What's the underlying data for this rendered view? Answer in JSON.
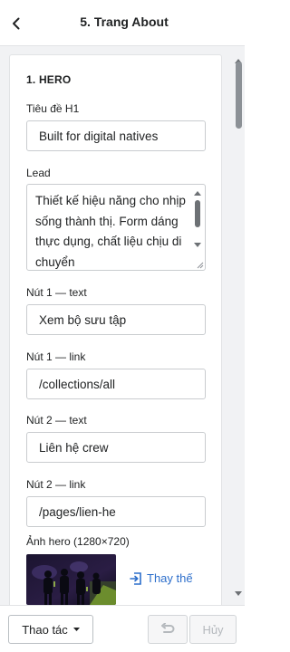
{
  "header": {
    "title": "5. Trang About",
    "back_icon": "chevron-left-icon"
  },
  "section": {
    "title": "1. HERO"
  },
  "fields": {
    "h1_label": "Tiêu đề H1",
    "h1_value": "Built for digital natives",
    "lead_label": "Lead",
    "lead_value": "Thiết kế hiệu năng cho nhịp sống thành thị. Form dáng thực dụng, chất liệu chịu di chuyển",
    "btn1_text_label": "Nút 1 — text",
    "btn1_text_value": "Xem bộ sưu tập",
    "btn1_link_label": "Nút 1 — link",
    "btn1_link_value": "/collections/all",
    "btn2_text_label": "Nút 2 — text",
    "btn2_text_value": "Liên hệ crew",
    "btn2_link_label": "Nút 2 — link",
    "btn2_link_value": "/pages/lien-he",
    "hero_image_label": "Ảnh hero (1280×720)",
    "replace_label": "Thay thế"
  },
  "footer": {
    "actions_label": "Thao tác",
    "cancel_label": "Hủy",
    "undo_icon": "undo-icon"
  },
  "colors": {
    "link": "#2c6ecb",
    "text": "#202223",
    "border": "#c9cccf",
    "panel_bg": "#f1f2f4"
  }
}
